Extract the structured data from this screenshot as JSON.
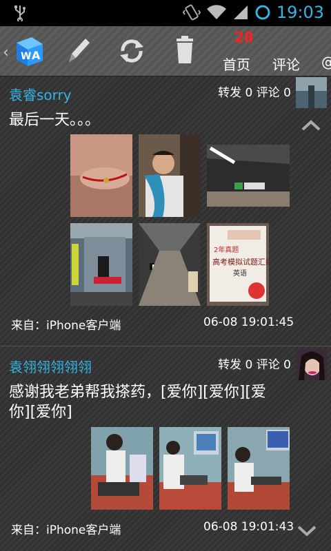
{
  "status_bar": {
    "time": "19:03",
    "icons": [
      "usb-icon",
      "vibrate-icon",
      "wifi-icon",
      "signal-icon",
      "battery-icon"
    ]
  },
  "toolbar": {
    "badge": "28",
    "tabs": [
      "首页",
      "评论",
      "@"
    ],
    "icons": [
      "app-logo-icon",
      "pencil-icon",
      "refresh-icon",
      "trash-icon"
    ]
  },
  "posts": [
    {
      "author": "袁睿sorry",
      "repost_label": "转发",
      "repost_count": "0",
      "comment_label": "评论",
      "comment_count": "0",
      "text": "最后一天。。。",
      "source": "来自：iPhone客户端",
      "time": "06-08 19:01:45"
    },
    {
      "author": "袁翎翎翎翎翎",
      "repost_label": "转发",
      "repost_count": "0",
      "comment_label": "评论",
      "comment_count": "0",
      "text_line1": "感谢我老弟帮我搽药，[爱你][爱你][爱",
      "text_line2": "你][爱你]",
      "source": "来自：iPhone客户端",
      "time": "06-08 19:01:43"
    }
  ]
}
